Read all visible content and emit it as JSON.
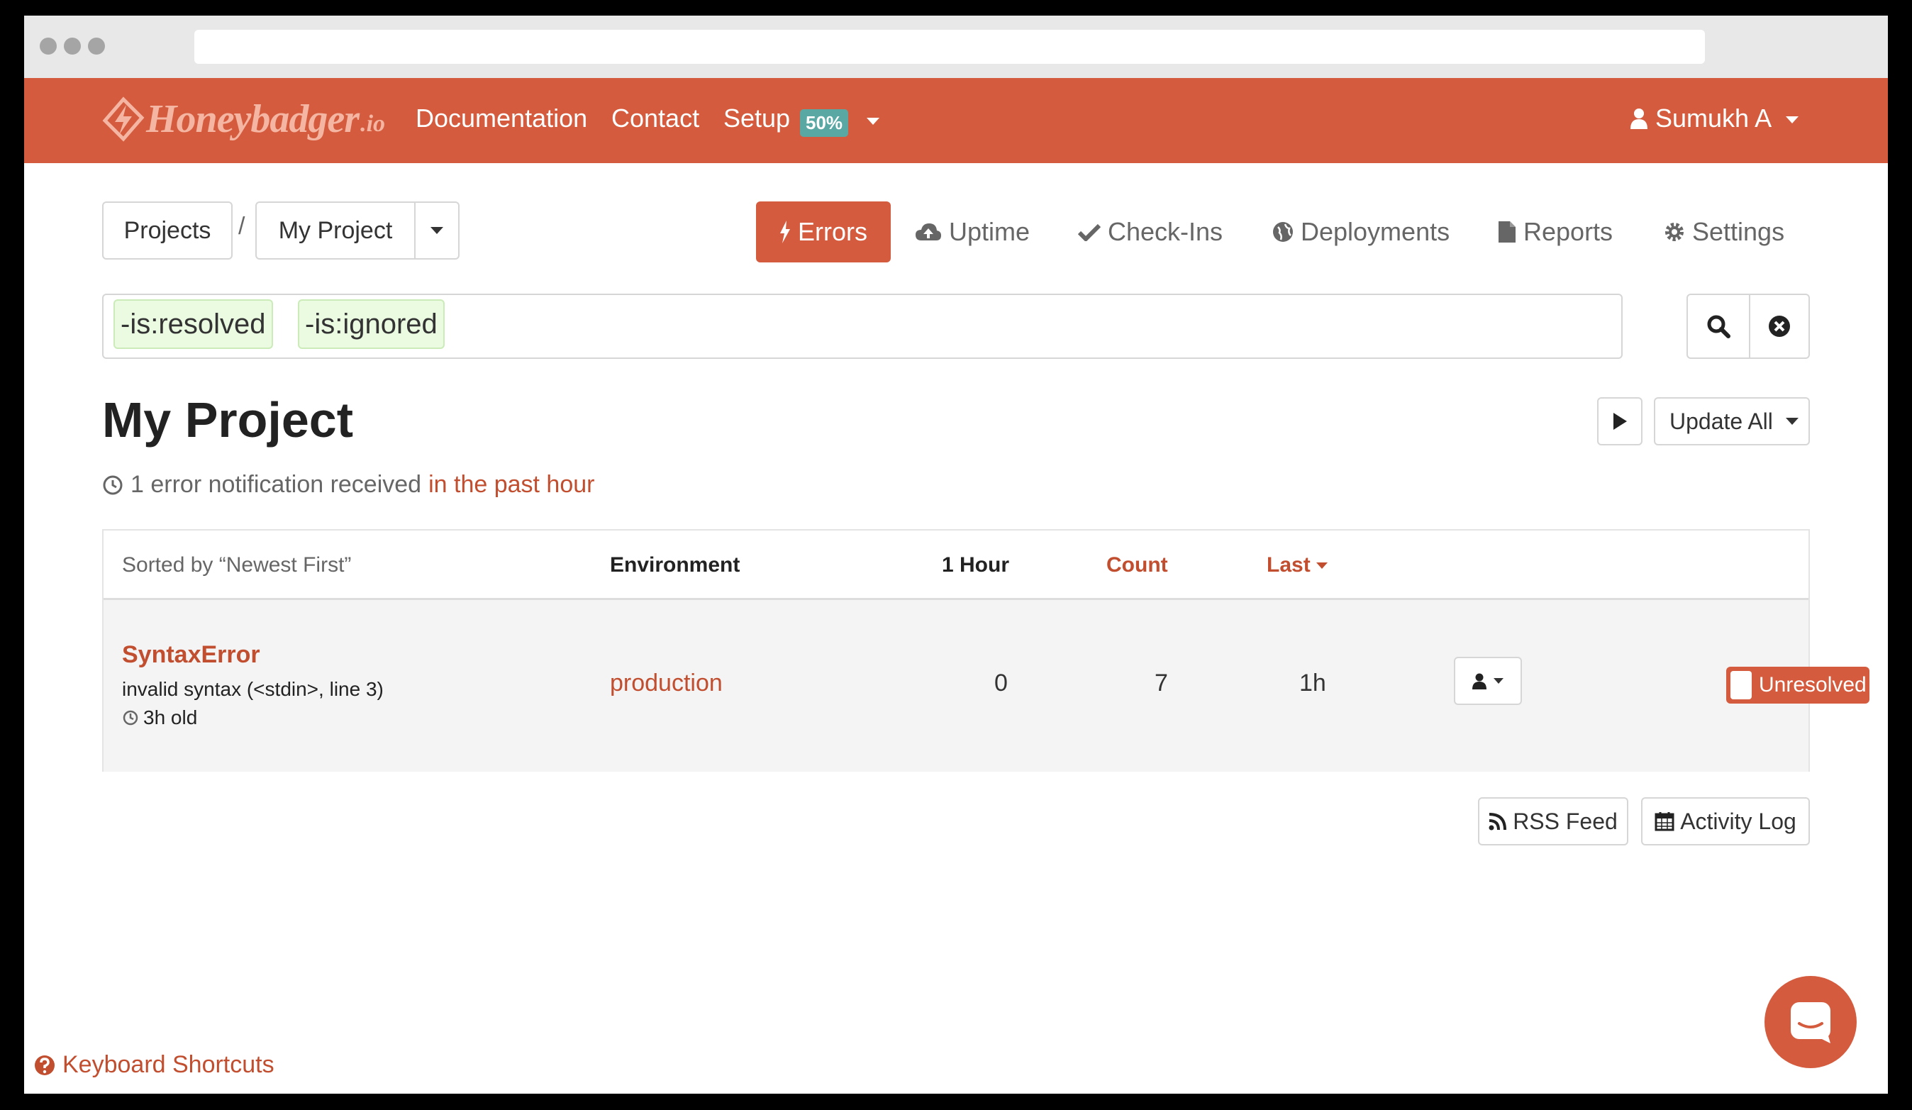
{
  "navbar": {
    "logo_text": "Honeybadger",
    "logo_suffix": ".io",
    "links": [
      "Documentation",
      "Contact",
      "Setup"
    ],
    "setup_badge": "50%",
    "user_name": "Sumukh A"
  },
  "breadcrumb": {
    "projects_label": "Projects",
    "separator": "/",
    "project_label": "My Project"
  },
  "tabs": {
    "errors": "Errors",
    "uptime": "Uptime",
    "checkins": "Check-Ins",
    "deployments": "Deployments",
    "reports": "Reports",
    "settings": "Settings"
  },
  "search": {
    "chips": [
      "-is:resolved",
      "-is:ignored"
    ]
  },
  "header": {
    "title": "My Project",
    "subtitle_prefix": "1 error notification received",
    "subtitle_accent": "in the past hour",
    "update_all_label": "Update All"
  },
  "table": {
    "sort_label": "Sorted by “Newest First”",
    "columns": {
      "environment": "Environment",
      "hour": "1 Hour",
      "count": "Count",
      "last": "Last"
    },
    "rows": [
      {
        "error_class": "SyntaxError",
        "message": "invalid syntax (<stdin>, line 3)",
        "age": "3h old",
        "environment": "production",
        "hour": "0",
        "count": "7",
        "last": "1h",
        "status": "Unresolved"
      }
    ]
  },
  "actions": {
    "rss_label": "RSS Feed",
    "activity_label": "Activity Log"
  },
  "footer": {
    "shortcuts_label": "Keyboard Shortcuts"
  },
  "colors": {
    "brand": "#d45b3d",
    "accent_text": "#c14e2f",
    "badge": "#5aa8a4",
    "chip_bg": "#eafbe1"
  }
}
